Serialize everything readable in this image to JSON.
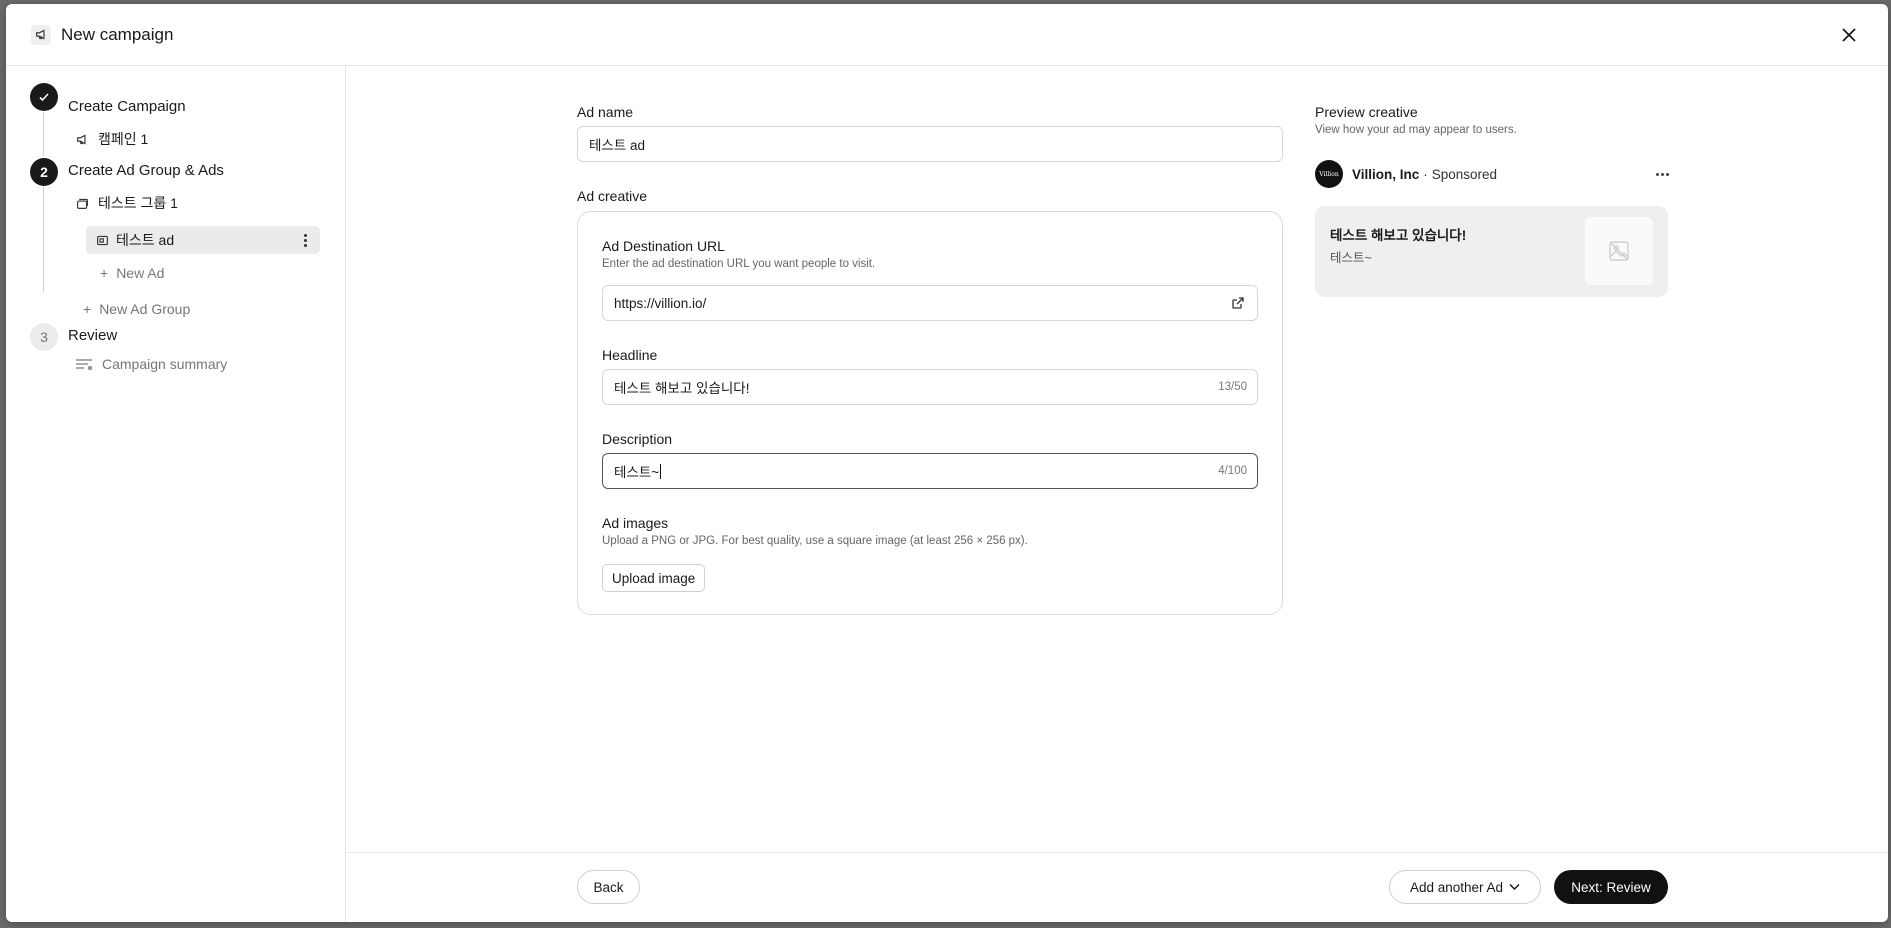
{
  "header": {
    "title": "New campaign",
    "icon": "megaphone-icon"
  },
  "sidebar": {
    "steps": [
      {
        "number": "",
        "label": "Create Campaign",
        "state": "done"
      },
      {
        "number": "2",
        "label": "Create Ad Group & Ads",
        "state": "active"
      },
      {
        "number": "3",
        "label": "Review",
        "state": "pending"
      }
    ],
    "campaign_item": "캠페인 1",
    "ad_group_item": "테스트 그룹 1",
    "ad_item": "테스트 ad",
    "new_ad": "New Ad",
    "new_ad_group": "New Ad Group",
    "campaign_summary": "Campaign summary"
  },
  "form": {
    "ad_name_label": "Ad name",
    "ad_name_value": "테스트 ad",
    "ad_creative_label": "Ad creative",
    "dest_url_label": "Ad Destination URL",
    "dest_url_help": "Enter the ad destination URL you want people to visit.",
    "dest_url_value": "https://villion.io/",
    "headline_label": "Headline",
    "headline_value": "테스트 해보고 있습니다!",
    "headline_counter": "13/50",
    "description_label": "Description",
    "description_value": "테스트~",
    "description_counter": "4/100",
    "ad_images_label": "Ad images",
    "ad_images_help": "Upload a PNG or JPG. For best quality, use a square image (at least 256 × 256 px).",
    "upload_button": "Upload image"
  },
  "preview": {
    "title": "Preview creative",
    "subtitle": "View how your ad may appear to users.",
    "brand_logo_text": "Villion",
    "brand_name": "Villion, Inc",
    "separator": "·",
    "sponsored": "Sponsored",
    "headline": "테스트 해보고 있습니다!",
    "description": "테스트~"
  },
  "footer": {
    "back": "Back",
    "add_another": "Add another Ad",
    "next": "Next: Review"
  }
}
